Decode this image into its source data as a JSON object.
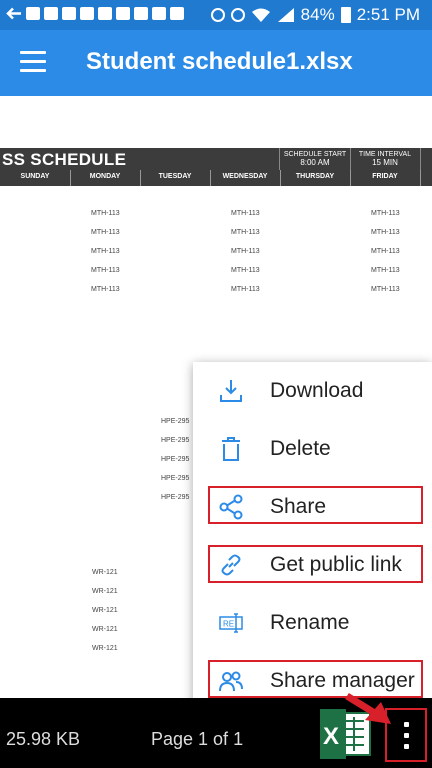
{
  "status_bar": {
    "battery": "84%",
    "time": "2:51 PM"
  },
  "app_bar": {
    "title": "Student schedule1.xlsx"
  },
  "sheet": {
    "title": "SS SCHEDULE",
    "schedule_start_label": "SCHEDULE START",
    "schedule_start_value": "8:00 AM",
    "time_interval_label": "TIME INTERVAL",
    "time_interval_value": "15 MIN",
    "days": [
      "SUNDAY",
      "MONDAY",
      "TUESDAY",
      "WEDNESDAY",
      "THURSDAY",
      "FRIDAY"
    ],
    "mth": "MTH-113",
    "hpe": "HPE-295",
    "wr": "WR-121"
  },
  "menu": {
    "download": "Download",
    "delete": "Delete",
    "share": "Share",
    "get_public_link": "Get public link",
    "rename": "Rename",
    "share_manager": "Share manager"
  },
  "bottom_bar": {
    "file_size": "25.98 KB",
    "page": "Page 1 of 1"
  },
  "colors": {
    "status_bar": "#1f7ad0",
    "app_bar": "#2c8be6",
    "icon_blue": "#2c8be6",
    "highlight": "#d8202a"
  }
}
